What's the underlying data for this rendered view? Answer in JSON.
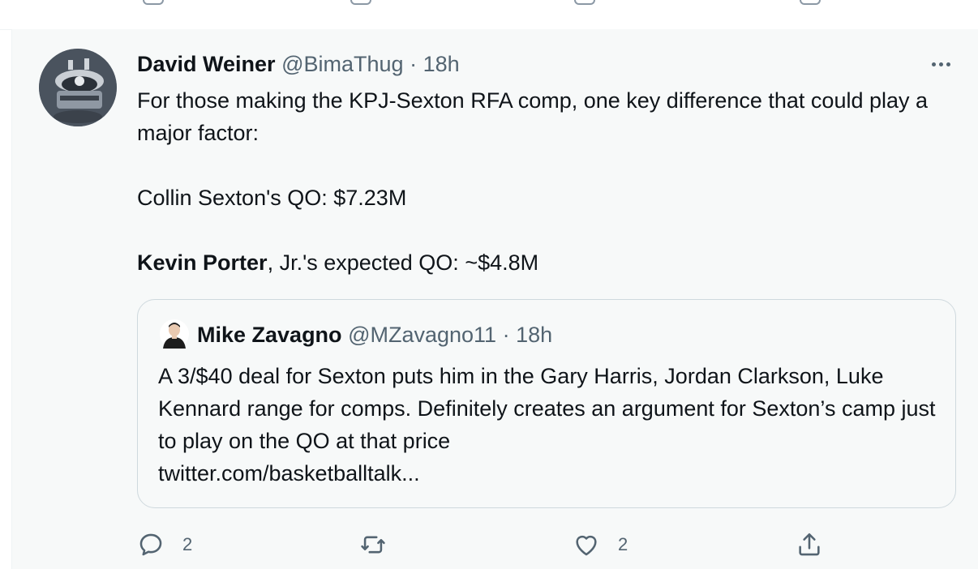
{
  "tweet": {
    "author_name": "David Weiner",
    "author_handle": "@BimaThug",
    "separator": "·",
    "time": "18h",
    "line1": "For those making the KPJ-Sexton RFA comp, one key difference that could play a major factor:",
    "line2": "Collin Sexton's QO: $7.23M",
    "line3_bold": "Kevin Porter",
    "line3_rest": ", Jr.'s expected QO: ~$4.8M",
    "more_icon": "more-horizontal-icon"
  },
  "quoted": {
    "author_name": "Mike Zavagno",
    "author_handle": "@MZavagno11",
    "separator": "·",
    "time": "18h",
    "text": "A 3/$40 deal for Sexton puts him in the Gary Harris, Jordan Clarkson, Luke Kennard range for comps. Definitely creates an argument for Sexton’s camp just to play on the QO at that price",
    "link": "twitter.com/basketballtalk..."
  },
  "actions": {
    "reply_count": "2",
    "retweet_count": "",
    "like_count": "2",
    "icons": [
      "reply-icon",
      "retweet-icon",
      "like-icon",
      "share-icon"
    ]
  },
  "colors": {
    "background": "#f7f9f9",
    "text": "#0f1419",
    "secondary": "#536471",
    "border": "#cfd9de"
  }
}
